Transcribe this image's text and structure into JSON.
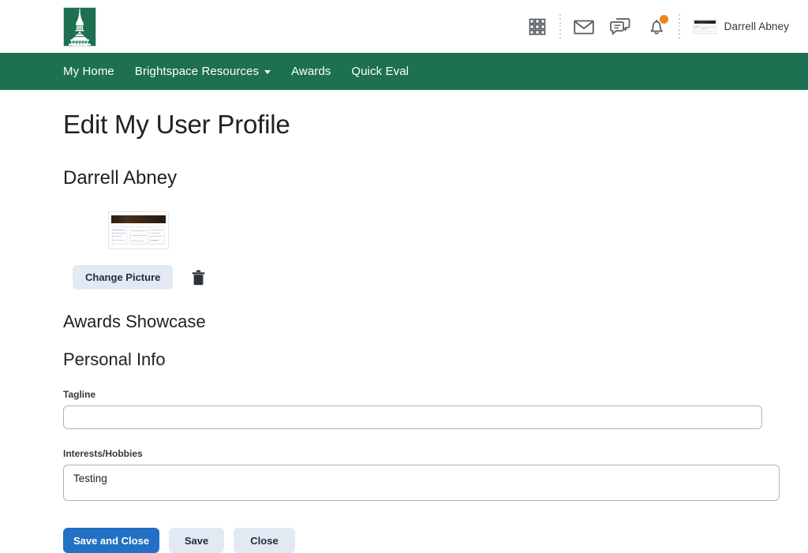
{
  "colors": {
    "brand_green": "#1d7050",
    "primary_blue": "#2271c4",
    "badge_orange": "#f08220",
    "secondary_button": "#e3e9f3",
    "text": "#202122"
  },
  "header": {
    "logo_alt": "university-tower-logo",
    "icons": [
      {
        "name": "waffle-menu-icon",
        "label": "Course selector"
      },
      {
        "name": "envelope-icon",
        "label": "Email"
      },
      {
        "name": "chat-bubbles-icon",
        "label": "Subscription alerts"
      },
      {
        "name": "bell-icon",
        "label": "Update alerts"
      }
    ],
    "notification_badge": true,
    "user": {
      "name": "Darrell Abney",
      "avatar_alt": "user-profile-thumbnail"
    }
  },
  "nav": {
    "items": [
      {
        "label": "My Home",
        "has_dropdown": false
      },
      {
        "label": "Brightspace Resources",
        "has_dropdown": true
      },
      {
        "label": "Awards",
        "has_dropdown": false
      },
      {
        "label": "Quick Eval",
        "has_dropdown": false
      }
    ]
  },
  "main": {
    "page_title": "Edit My User Profile",
    "person_name": "Darrell Abney",
    "profile_picture": {
      "alt": "profile-picture-preview",
      "change_label": "Change Picture",
      "delete_label": "Delete Picture"
    },
    "sections": [
      {
        "title": "Awards Showcase"
      },
      {
        "title": "Personal Info"
      }
    ],
    "fields": [
      {
        "label": "Tagline",
        "value": "",
        "placeholder": "",
        "type": "text"
      },
      {
        "label": "Interests/Hobbies",
        "value": "Testing",
        "placeholder": "",
        "type": "textarea"
      }
    ],
    "actions": [
      {
        "label": "Save and Close",
        "style": "primary"
      },
      {
        "label": "Save",
        "style": "secondary"
      },
      {
        "label": "Close",
        "style": "secondary"
      }
    ]
  }
}
